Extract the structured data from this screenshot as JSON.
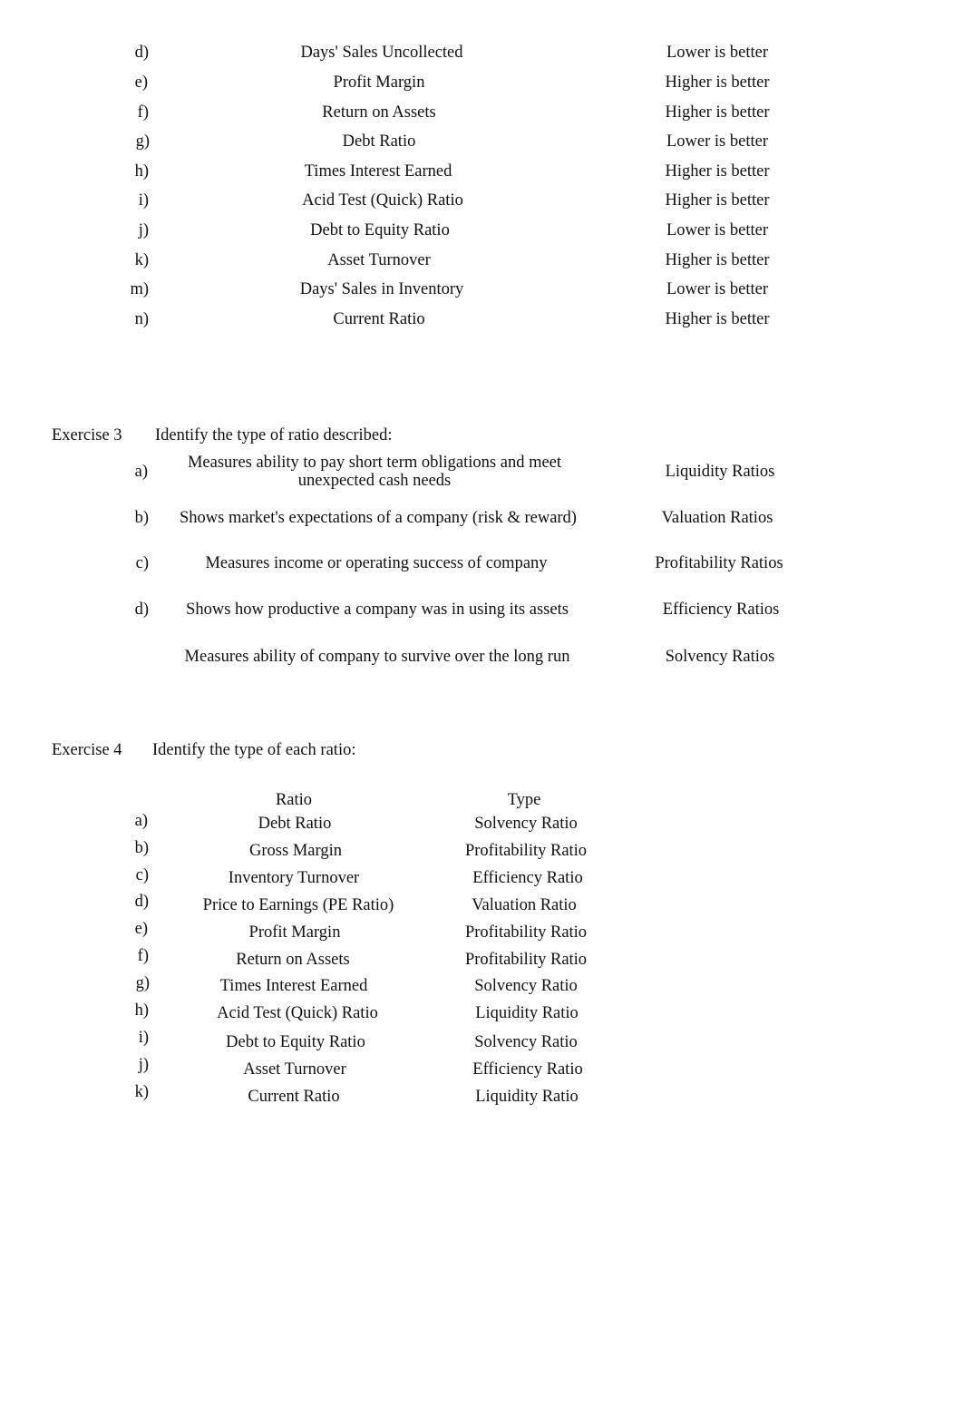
{
  "exercise2_continued": {
    "rows": [
      {
        "letter": "d)",
        "ratio": "Days' Sales Uncollected",
        "direction": "Lower is better"
      },
      {
        "letter": "e)",
        "ratio": "Profit Margin",
        "direction": "Higher is better"
      },
      {
        "letter": "f)",
        "ratio": "Return on Assets",
        "direction": "Higher is better"
      },
      {
        "letter": "g)",
        "ratio": "Debt Ratio",
        "direction": "Lower is better"
      },
      {
        "letter": "h)",
        "ratio": "Times Interest Earned",
        "direction": "Higher is better"
      },
      {
        "letter": "i)",
        "ratio": "Acid Test (Quick) Ratio",
        "direction": "Higher is better"
      },
      {
        "letter": "j)",
        "ratio": "Debt to Equity Ratio",
        "direction": "Lower is better"
      },
      {
        "letter": "k)",
        "ratio": "Asset Turnover",
        "direction": "Higher is better"
      },
      {
        "letter": "m)",
        "ratio": "Days' Sales in Inventory",
        "direction": "Lower is better"
      },
      {
        "letter": "n)",
        "ratio": "Current Ratio",
        "direction": "Higher is better"
      }
    ]
  },
  "exercise3": {
    "label": "Exercise 3",
    "instruction": "Identify the type of ratio described:",
    "rows": [
      {
        "letter": "a)",
        "description": "Measures ability to pay short term obligations and meet unexpected cash needs",
        "type": "Liquidity Ratios"
      },
      {
        "letter": "b)",
        "description": "Shows market's expectations of a company (risk & reward)",
        "type": "Valuation Ratios"
      },
      {
        "letter": "c)",
        "description": "Measures income or operating success of company",
        "type": "Profitability Ratios"
      },
      {
        "letter": "d)",
        "description": "Shows how productive a company was in using its assets",
        "type": "Efficiency Ratios"
      },
      {
        "letter": "",
        "description": "Measures ability of company to survive over the long run",
        "type": "Solvency Ratios"
      }
    ]
  },
  "exercise4": {
    "label": "Exercise 4",
    "instruction": "Identify the type of each ratio:",
    "headers": {
      "ratio": "Ratio",
      "type": "Type"
    },
    "rows": [
      {
        "letter": "a)",
        "ratio": "Debt Ratio",
        "type": "Solvency Ratio"
      },
      {
        "letter": "b)",
        "ratio": "Gross Margin",
        "type": "Profitability Ratio"
      },
      {
        "letter": "c)",
        "ratio": "Inventory Turnover",
        "type": "Efficiency Ratio"
      },
      {
        "letter": "d)",
        "ratio": "Price to Earnings (PE Ratio)",
        "type": "Valuation Ratio"
      },
      {
        "letter": "e)",
        "ratio": "Profit Margin",
        "type": "Profitability Ratio"
      },
      {
        "letter": "f)",
        "ratio": "Return on Assets",
        "type": "Profitability Ratio"
      },
      {
        "letter": "g)",
        "ratio": "Times Interest Earned",
        "type": "Solvency Ratio"
      },
      {
        "letter": "h)",
        "ratio": "Acid Test (Quick) Ratio",
        "type": "Liquidity Ratio"
      },
      {
        "letter": "i)",
        "ratio": "Debt to Equity Ratio",
        "type": "Solvency Ratio"
      },
      {
        "letter": "j)",
        "ratio": "Asset Turnover",
        "type": "Efficiency Ratio"
      },
      {
        "letter": "k)",
        "ratio": "Current Ratio",
        "type": "Liquidity Ratio"
      }
    ]
  }
}
